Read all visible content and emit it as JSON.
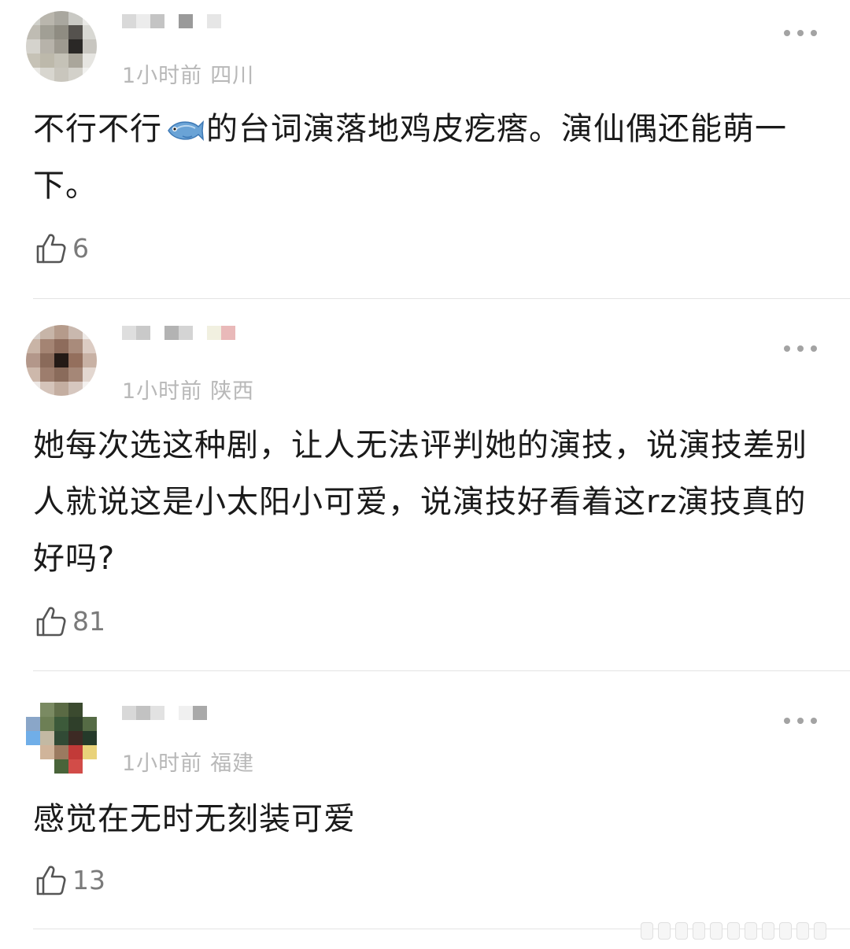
{
  "comments": [
    {
      "time": "1小时前",
      "location": "四川",
      "text_before_emoji": "不行不行",
      "emoji": "fish-emoji",
      "text_after_emoji": "的台词演落地鸡皮疙瘩。演仙偶还能萌一下。",
      "likes": "6"
    },
    {
      "time": "1小时前",
      "location": "陕西",
      "text": "她每次选这种剧，让人无法评判她的演技，说演技差别人就说这是小太阳小可爱，说演技好看着这rz演技真的好吗?",
      "likes": "81"
    },
    {
      "time": "1小时前",
      "location": "福建",
      "text": "感觉在无时无刻装可爱",
      "likes": "13"
    }
  ],
  "icons": {
    "like": "thumbs-up-icon",
    "more": "more-dots-icon"
  },
  "colors": {
    "meta_text": "#b8b8b8",
    "like_count": "#7a7a7a",
    "divider": "#e3e3e3"
  }
}
